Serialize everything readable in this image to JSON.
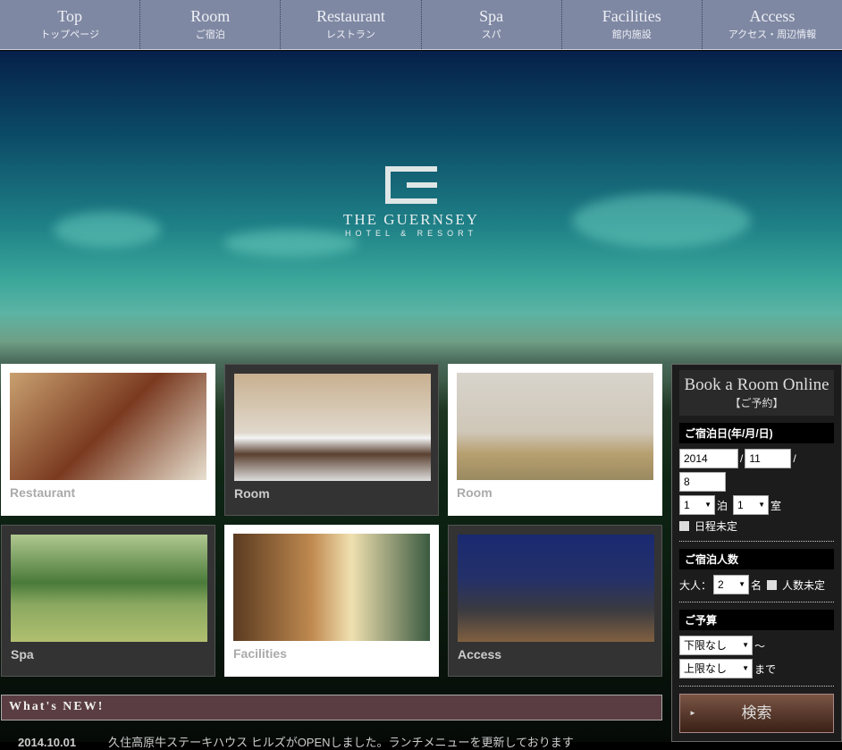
{
  "nav": [
    {
      "en": "Top",
      "ja": "トップページ"
    },
    {
      "en": "Room",
      "ja": "ご宿泊"
    },
    {
      "en": "Restaurant",
      "ja": "レストラン"
    },
    {
      "en": "Spa",
      "ja": "スパ"
    },
    {
      "en": "Facilities",
      "ja": "館内施設"
    },
    {
      "en": "Access",
      "ja": "アクセス・周辺情報"
    }
  ],
  "logo": {
    "name": "THE GUERNSEY",
    "sub": "HOTEL & RESORT"
  },
  "cards": [
    {
      "label": "Restaurant"
    },
    {
      "label": "Room"
    },
    {
      "label": "Room"
    },
    {
      "label": "Spa"
    },
    {
      "label": "Facilities"
    },
    {
      "label": "Access"
    }
  ],
  "booking": {
    "title": "Book a Room Online",
    "subtitle": "【ご予約】",
    "date_label": "ご宿泊日(年/月/日)",
    "year": "2014",
    "month": "11",
    "day": "8",
    "sep": "/",
    "nights": "1",
    "nights_unit": "泊",
    "rooms": "1",
    "rooms_unit": "室",
    "undecided_date": "日程未定",
    "guests_label": "ご宿泊人数",
    "adults_label": "大人：",
    "adults": "2",
    "adults_unit": "名",
    "undecided_guests": "人数未定",
    "budget_label": "ご予算",
    "budget_min": "下限なし",
    "tilde": "～",
    "budget_max": "上限なし",
    "made": "まで",
    "search": "検索"
  },
  "news": {
    "title": "What's NEW!",
    "items": [
      {
        "date": "2014.10.01",
        "text": "久住高原牛ステーキハウス ヒルズがOPENしました。ランチメニューを更新しております"
      }
    ]
  }
}
